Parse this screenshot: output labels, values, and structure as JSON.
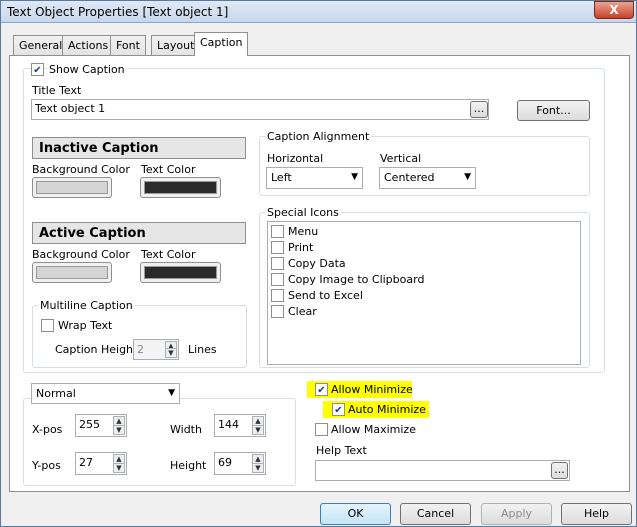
{
  "window": {
    "title": "Text Object Properties [Text object 1]",
    "close_label": "X"
  },
  "tabs": [
    "General",
    "Actions",
    "Font",
    "Layout",
    "Caption"
  ],
  "show_caption": {
    "label": "Show Caption",
    "checked": true
  },
  "title_text": {
    "label": "Title Text",
    "value": "Text object 1",
    "browse": "...",
    "font_button": "Font..."
  },
  "inactive_caption": {
    "header": "Inactive Caption",
    "bg_label": "Background Color",
    "text_label": "Text Color"
  },
  "active_caption": {
    "header": "Active Caption",
    "bg_label": "Background Color",
    "text_label": "Text Color"
  },
  "caption_alignment": {
    "legend": "Caption Alignment",
    "horizontal_label": "Horizontal",
    "horizontal_value": "Left",
    "vertical_label": "Vertical",
    "vertical_value": "Centered"
  },
  "special_icons": {
    "legend": "Special Icons",
    "items": [
      "Menu",
      "Print",
      "Copy Data",
      "Copy Image to Clipboard",
      "Send to Excel",
      "Clear"
    ]
  },
  "multiline": {
    "legend": "Multiline Caption",
    "wrap_label": "Wrap Text",
    "height_label": "Caption Height",
    "height_value": "2",
    "lines_label": "Lines"
  },
  "position": {
    "mode": "Normal",
    "xpos_label": "X-pos",
    "xpos": "255",
    "ypos_label": "Y-pos",
    "ypos": "27",
    "width_label": "Width",
    "width": "144",
    "height_label": "Height",
    "height": "69"
  },
  "minimize": {
    "allow_minimize": "Allow Minimize",
    "auto_minimize": "Auto Minimize",
    "allow_maximize": "Allow Maximize",
    "help_text_label": "Help Text",
    "browse": "..."
  },
  "footer": {
    "ok": "OK",
    "cancel": "Cancel",
    "apply": "Apply",
    "help": "Help"
  },
  "colors": {
    "swatch_light": "#d4d4d4",
    "swatch_dark": "#2b2b2b",
    "highlight": "#ffff00"
  }
}
